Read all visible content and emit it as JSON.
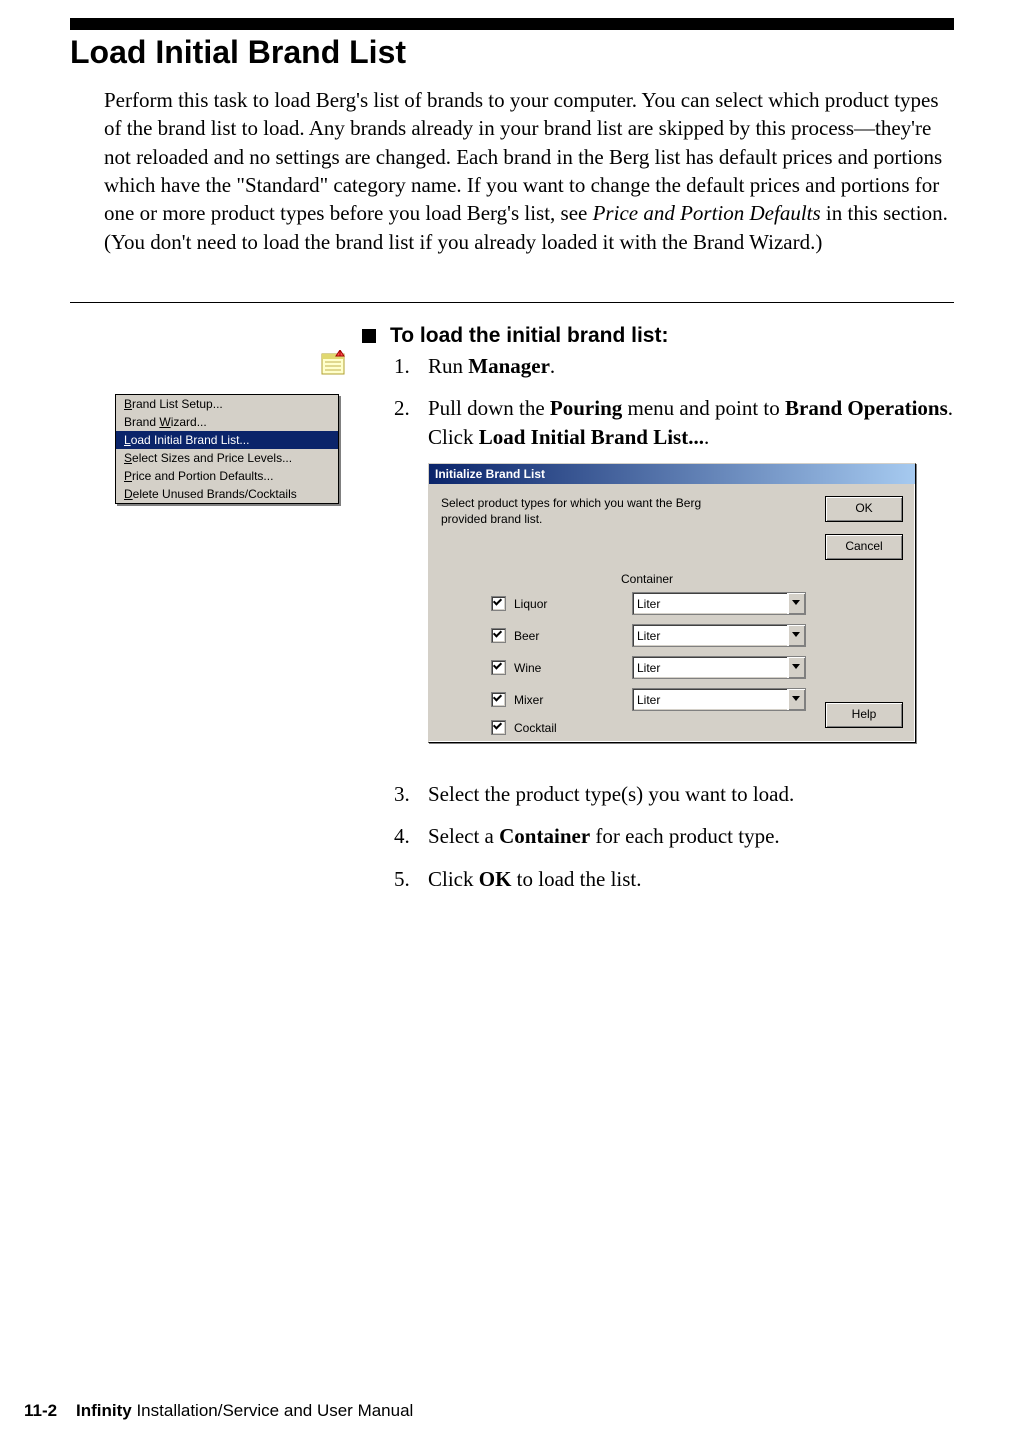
{
  "heading": "Load Initial Brand List",
  "intro": {
    "pre": "Perform this task to load Berg's list of brands to your computer. You can select which product types of the brand list to load. Any brands already in your brand list are skipped by this process—they're not reloaded and no settings are changed. Each brand in the Berg list has default prices and portions which have the \"Standard\" category name. If you want to change the default prices and portions for one or more product types before you load Berg's list, see ",
    "italic": "Price and Portion Defaults",
    "post": " in this section. (You don't need to load the brand list if you already loaded it with the Brand Wizard.)"
  },
  "task_title": "To load the initial brand list:",
  "steps_top": [
    {
      "num": "1.",
      "parts": [
        "Run ",
        {
          "b": "Manager"
        },
        "."
      ]
    },
    {
      "num": "2.",
      "parts": [
        "Pull down the ",
        {
          "b": "Pouring"
        },
        " menu and point to ",
        {
          "b": "Brand Operations"
        },
        ". Click ",
        {
          "b": "Load Initial Brand List..."
        },
        "."
      ]
    }
  ],
  "steps_bottom": [
    {
      "num": "3.",
      "parts": [
        "Select the product type(s) you want to load."
      ]
    },
    {
      "num": "4.",
      "parts": [
        "Select a ",
        {
          "b": "Container"
        },
        " for each product type."
      ]
    },
    {
      "num": "5.",
      "parts": [
        "Click ",
        {
          "b": "OK"
        },
        " to load the list."
      ]
    }
  ],
  "menu": {
    "items": [
      {
        "pre": "",
        "ul": "B",
        "post": "rand List Setup...",
        "selected": false
      },
      {
        "pre": "Brand ",
        "ul": "W",
        "post": "izard...",
        "selected": false
      },
      {
        "pre": "",
        "ul": "L",
        "post": "oad Initial Brand List...",
        "selected": true
      },
      {
        "pre": "",
        "ul": "S",
        "post": "elect Sizes and Price Levels...",
        "selected": false
      },
      {
        "pre": "",
        "ul": "P",
        "post": "rice and Portion Defaults...",
        "selected": false
      },
      {
        "pre": "",
        "ul": "D",
        "post": "elete Unused Brands/Cocktails",
        "selected": false
      }
    ]
  },
  "dialog": {
    "title": "Initialize Brand List",
    "instruction": "Select product types for which you want the Berg provided brand list.",
    "container_header": "Container",
    "buttons": {
      "ok": "OK",
      "cancel": "Cancel",
      "help": "Help"
    },
    "rows": [
      {
        "label": "Liquor",
        "value": "Liter",
        "has_combo": true
      },
      {
        "label": "Beer",
        "value": "Liter",
        "has_combo": true
      },
      {
        "label": "Wine",
        "value": "Liter",
        "has_combo": true
      },
      {
        "label": "Mixer",
        "value": "Liter",
        "has_combo": true
      },
      {
        "label": "Cocktail",
        "value": "",
        "has_combo": false
      }
    ]
  },
  "footer": {
    "page": "11-2",
    "bold": "Infinity",
    "rest": " Installation/Service and User Manual"
  }
}
